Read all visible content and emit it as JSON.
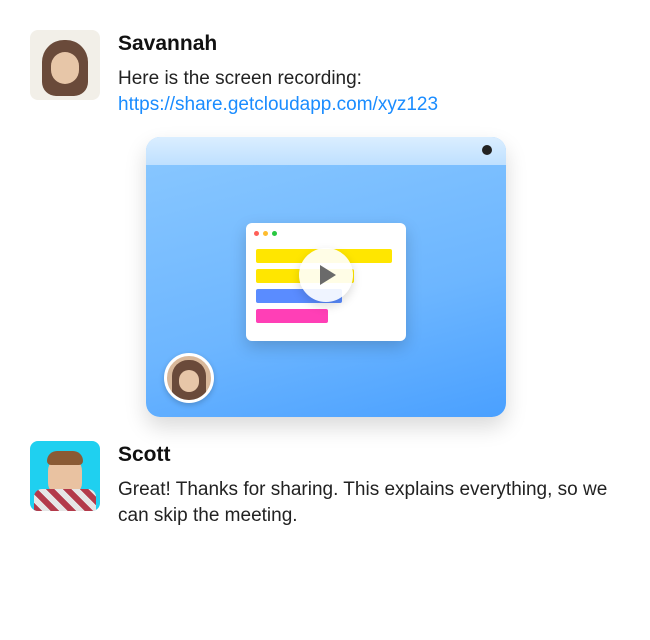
{
  "messages": [
    {
      "sender": "Savannah",
      "text_intro": "Here is the screen recording:",
      "link_text": "https://share.getcloudapp.com/xyz123"
    },
    {
      "sender": "Scott",
      "text": "Great! Thanks for sharing. This explains everything, so we can skip the meeting."
    }
  ],
  "preview": {
    "play_icon": "play-icon",
    "presenter": "savannah-bubble"
  },
  "colors": {
    "link": "#1a8cff"
  }
}
